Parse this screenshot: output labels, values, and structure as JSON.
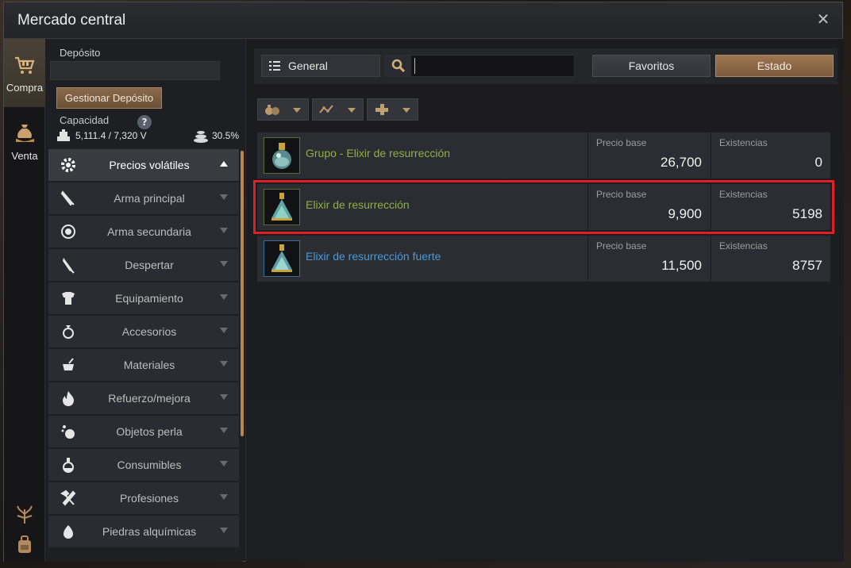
{
  "window": {
    "title": "Mercado central"
  },
  "leftnav": {
    "items": [
      {
        "label": "Compra",
        "icon": "cart-icon"
      },
      {
        "label": "Venta",
        "icon": "money-bag-icon"
      }
    ]
  },
  "sidebar": {
    "deposit_label": "Depósito",
    "manage_button": "Gestionar Depósito",
    "capacity_label": "Capacidad",
    "weight_value": "5,111.4 / 7,320 V",
    "weight_percent": "30.5%",
    "categories": [
      {
        "label": "Precios volátiles",
        "icon": "gear-icon",
        "active": true
      },
      {
        "label": "Arma principal",
        "icon": "sword-icon"
      },
      {
        "label": "Arma secundaria",
        "icon": "shield-icon"
      },
      {
        "label": "Despertar",
        "icon": "blade-icon"
      },
      {
        "label": "Equipamiento",
        "icon": "armor-icon"
      },
      {
        "label": "Accesorios",
        "icon": "ring-icon"
      },
      {
        "label": "Materiales",
        "icon": "mortar-icon"
      },
      {
        "label": "Refuerzo/mejora",
        "icon": "flame-icon"
      },
      {
        "label": "Objetos perla",
        "icon": "pearl-icon"
      },
      {
        "label": "Consumibles",
        "icon": "potion-icon"
      },
      {
        "label": "Profesiones",
        "icon": "tools-icon"
      },
      {
        "label": "Piedras alquímicas",
        "icon": "stone-icon"
      }
    ]
  },
  "toolbar": {
    "category_select": "General",
    "search_value": "",
    "favorites_button": "Favoritos",
    "status_button": "Estado"
  },
  "items": [
    {
      "name": "Grupo - Elixir de resurrección",
      "name_color": "#8fae48",
      "price_label": "Precio base",
      "price": "26,700",
      "stock_label": "Existencias",
      "stock": "0",
      "highlighted": false
    },
    {
      "name": "Elixir de resurrección",
      "name_color": "#8fae48",
      "price_label": "Precio base",
      "price": "9,900",
      "stock_label": "Existencias",
      "stock": "5198",
      "highlighted": true
    },
    {
      "name": "Elixir de resurrección fuerte",
      "name_color": "#4a9ad6",
      "price_label": "Precio base",
      "price": "11,500",
      "stock_label": "Existencias",
      "stock": "8757",
      "highlighted": false
    }
  ],
  "colors": {
    "accent": "#8a6a4b",
    "highlight": "#e01e25"
  }
}
